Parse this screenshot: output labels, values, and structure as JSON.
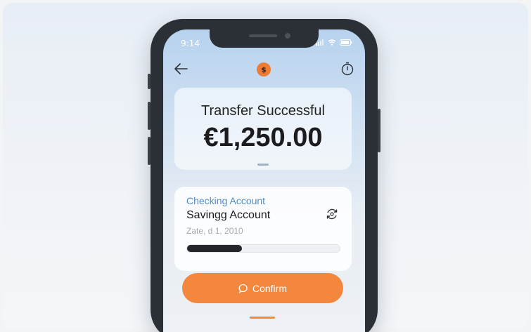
{
  "status_bar": {
    "time": "9:14"
  },
  "header": {
    "logo_glyph": "$",
    "icons": [
      "back-arrow-icon",
      "timer-icon"
    ]
  },
  "transfer": {
    "title": "Transfer Successful",
    "amount": "€1,250.00"
  },
  "account": {
    "from": "Checking Account",
    "to": "Savingg Account",
    "date": "Zate, d 1, 2010",
    "progress": 0.36
  },
  "actions": {
    "confirm_label": "Confirm"
  },
  "colors": {
    "accent": "#f3873e",
    "link_blue": "#4f8dc4",
    "dark": "#23262b"
  }
}
